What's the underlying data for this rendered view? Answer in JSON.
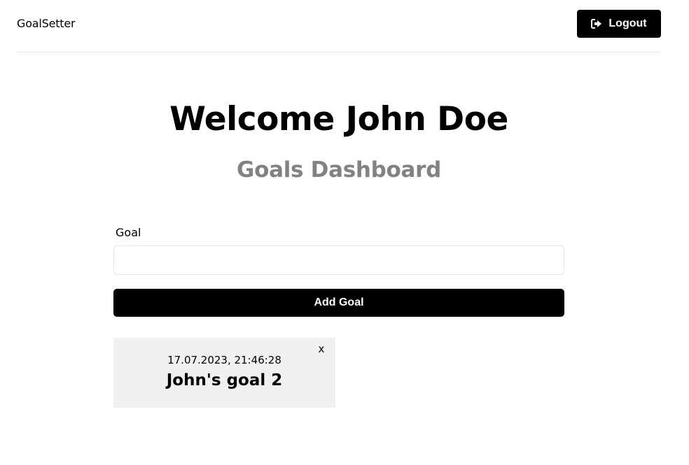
{
  "header": {
    "logo": "GoalSetter",
    "logout_label": "Logout",
    "logout_icon": "sign-out-icon"
  },
  "main": {
    "welcome": "Welcome John Doe",
    "subtitle": "Goals Dashboard"
  },
  "form": {
    "goal_label": "Goal",
    "goal_value": "",
    "add_button_label": "Add Goal"
  },
  "goals": [
    {
      "date": "17.07.2023, 21:46:28",
      "text": "John's goal 2",
      "close_label": "x"
    }
  ],
  "colors": {
    "primary": "#000000",
    "subtitle": "#828282",
    "card_background": "#f0f0f0",
    "divider": "#e6e6e6"
  }
}
